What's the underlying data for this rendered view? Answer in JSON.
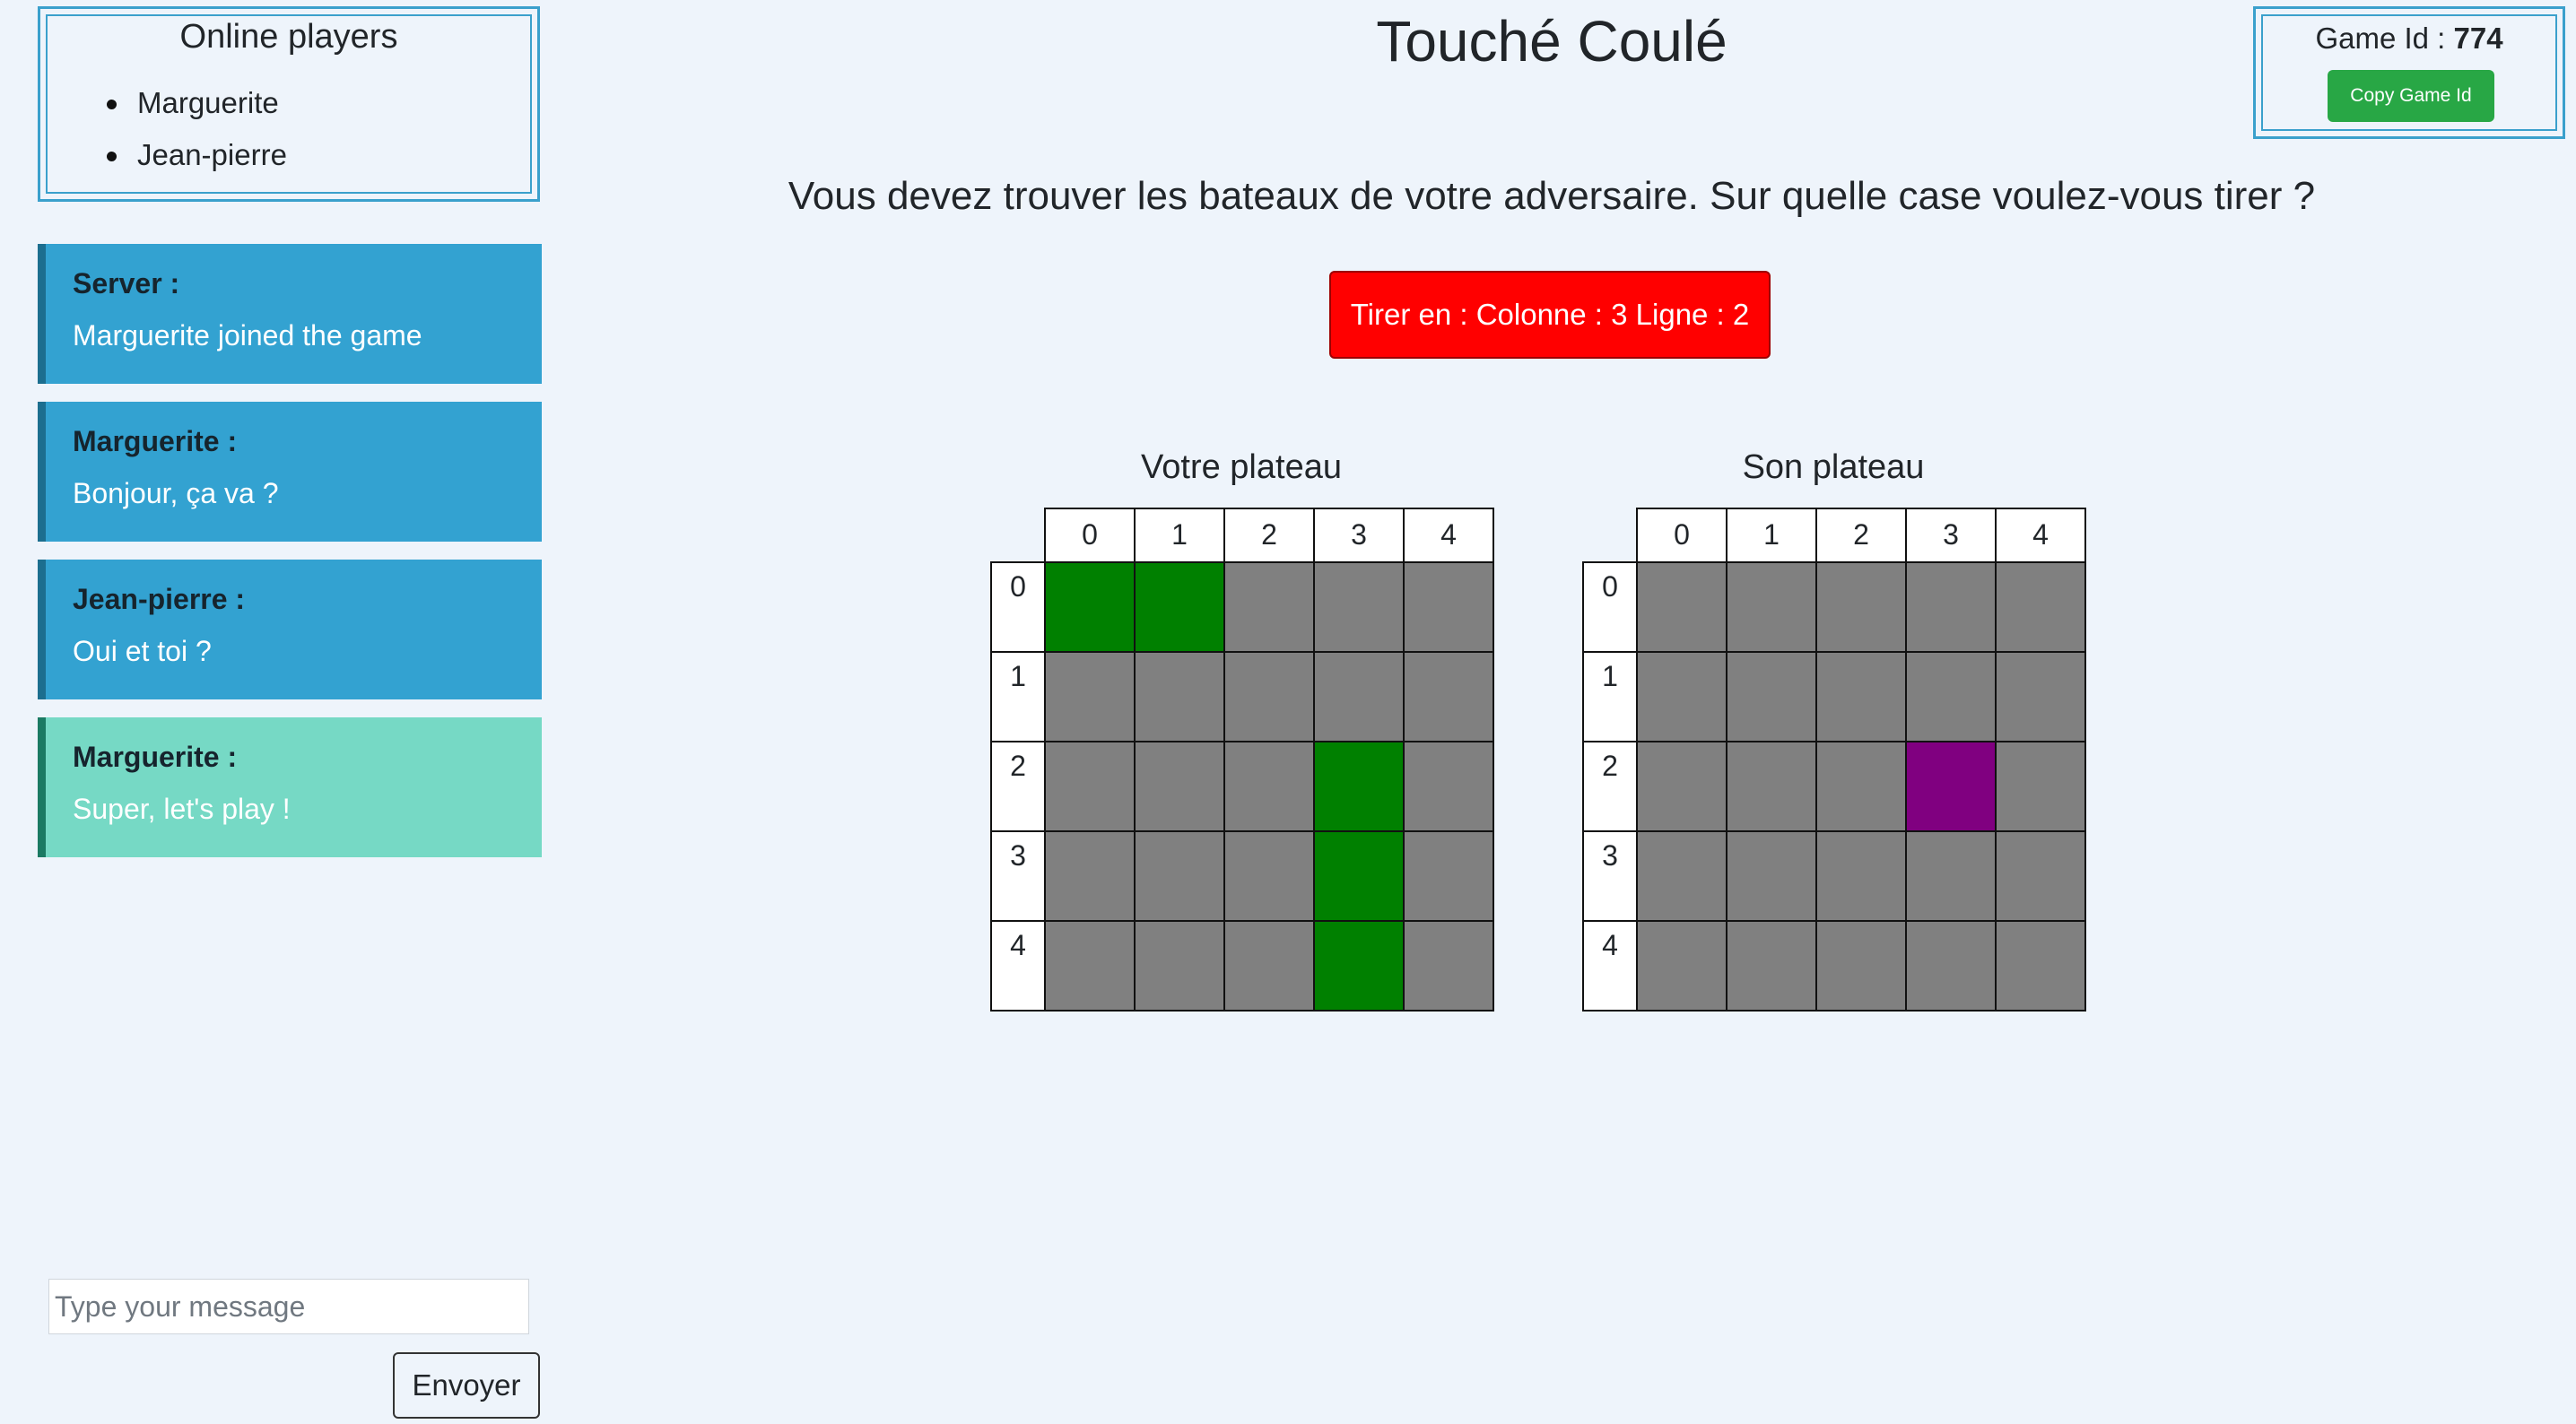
{
  "players_panel": {
    "title": "Online players",
    "players": [
      "Marguerite",
      "Jean-pierre"
    ]
  },
  "chat": {
    "messages": [
      {
        "author": "Server :",
        "text": "Marguerite joined the game",
        "own": false
      },
      {
        "author": "Marguerite :",
        "text": "Bonjour, ça va ?",
        "own": false
      },
      {
        "author": "Jean-pierre :",
        "text": "Oui et toi ?",
        "own": false
      },
      {
        "author": "Marguerite :",
        "text": "Super, let's play !",
        "own": true
      }
    ],
    "input_placeholder": "Type your message",
    "input_value": "",
    "send_label": "Envoyer"
  },
  "header": {
    "title": "Touché Coulé",
    "instruction": "Vous devez trouver les bateaux de votre adversaire. Sur quelle case voulez-vous tirer ?",
    "fire_button": "Tirer en : Colonne : 3 Ligne : 2"
  },
  "game": {
    "id_label": "Game Id : ",
    "id": "774",
    "copy_label": "Copy Game Id"
  },
  "colors": {
    "empty": "#808080",
    "ship": "#008000",
    "target": "#800080",
    "fire_button": "#ff0000",
    "message_other": "#33a2d1",
    "message_own": "#76d9c5",
    "copy_button": "#28a745"
  },
  "boards": {
    "columns": [
      "0",
      "1",
      "2",
      "3",
      "4"
    ],
    "rows": [
      "0",
      "1",
      "2",
      "3",
      "4"
    ],
    "own": {
      "title": "Votre plateau",
      "cells": [
        [
          "ship",
          "ship",
          "empty",
          "empty",
          "empty"
        ],
        [
          "empty",
          "empty",
          "empty",
          "empty",
          "empty"
        ],
        [
          "empty",
          "empty",
          "empty",
          "ship",
          "empty"
        ],
        [
          "empty",
          "empty",
          "empty",
          "ship",
          "empty"
        ],
        [
          "empty",
          "empty",
          "empty",
          "ship",
          "empty"
        ]
      ]
    },
    "opponent": {
      "title": "Son plateau",
      "cells": [
        [
          "empty",
          "empty",
          "empty",
          "empty",
          "empty"
        ],
        [
          "empty",
          "empty",
          "empty",
          "empty",
          "empty"
        ],
        [
          "empty",
          "empty",
          "empty",
          "target",
          "empty"
        ],
        [
          "empty",
          "empty",
          "empty",
          "empty",
          "empty"
        ],
        [
          "empty",
          "empty",
          "empty",
          "empty",
          "empty"
        ]
      ]
    }
  }
}
